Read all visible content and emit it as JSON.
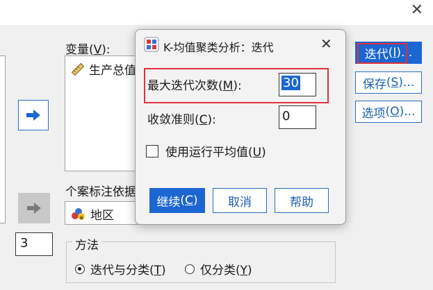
{
  "main": {
    "variables_label": "变量",
    "variables_hotkey": "V",
    "variables_suffix": "):",
    "variable_item": "生产总值",
    "case_label_label": "个案标注依据",
    "case_label_item": "地区",
    "clusters_value": "3",
    "method": {
      "title": "方法",
      "option1_label": "迭代与分类",
      "option1_hotkey": "T",
      "option2_label": "仅分类",
      "option2_hotkey": "Y"
    },
    "side_buttons": {
      "iterate_label": "迭代",
      "iterate_hotkey": "I",
      "save_label": "保存",
      "save_hotkey": "S",
      "options_label": "选项",
      "options_hotkey": "O",
      "ellipsis": "..."
    }
  },
  "dialog": {
    "title": "K-均值聚类分析：迭代",
    "max_iterations_label": "最大迭代次数",
    "max_iterations_hotkey": "M",
    "max_iterations_value": "30",
    "convergence_label": "收敛准则",
    "convergence_hotkey": "C",
    "convergence_value": "0",
    "running_means_label": "使用运行平均值",
    "running_means_hotkey": "U",
    "continue_label": "继续",
    "continue_hotkey": "C",
    "cancel_label": "取消",
    "help_label": "帮助"
  },
  "colors": {
    "accent": "#1b66d2",
    "highlight": "#e0303a"
  }
}
